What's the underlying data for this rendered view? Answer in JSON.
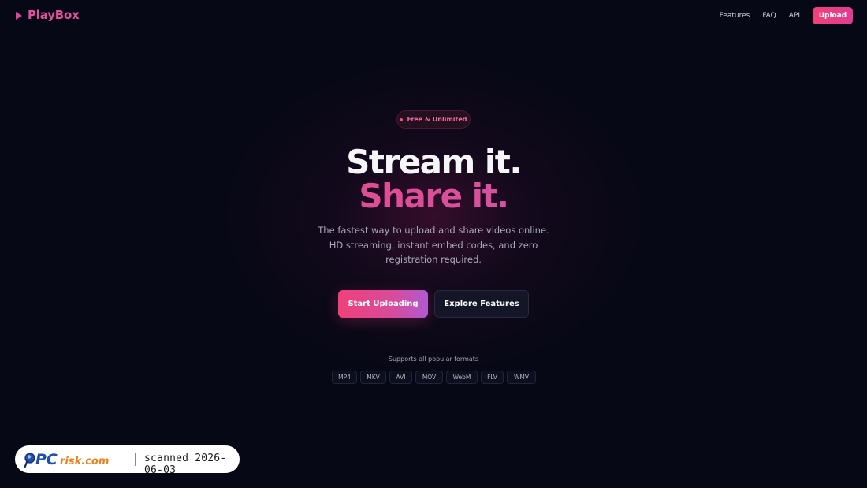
{
  "brand": {
    "name": "PlayBox",
    "icon": "play-triangle-icon",
    "color": "#e0509c"
  },
  "nav": {
    "links": [
      "Features",
      "FAQ",
      "API"
    ],
    "upload_label": "Upload"
  },
  "hero": {
    "badge": "Free & Unlimited",
    "headline_line1": "Stream it.",
    "headline_line2": "Share it.",
    "subtitle": "The fastest way to upload and share videos online. HD streaming, instant embed codes, and zero registration required.",
    "primary_cta": "Start Uploading",
    "secondary_cta": "Explore Features"
  },
  "formats": {
    "caption": "Supports all popular formats",
    "items": [
      "MP4",
      "MKV",
      "AVI",
      "MOV",
      "WebM",
      "FLV",
      "WMV"
    ]
  },
  "watermark": {
    "logo_text": "PCrisk.com",
    "stamp": "scanned 2026-06-03"
  },
  "colors": {
    "background": "#070815",
    "accent_pink": "#f0407a",
    "accent_purple": "#a65ad8"
  }
}
